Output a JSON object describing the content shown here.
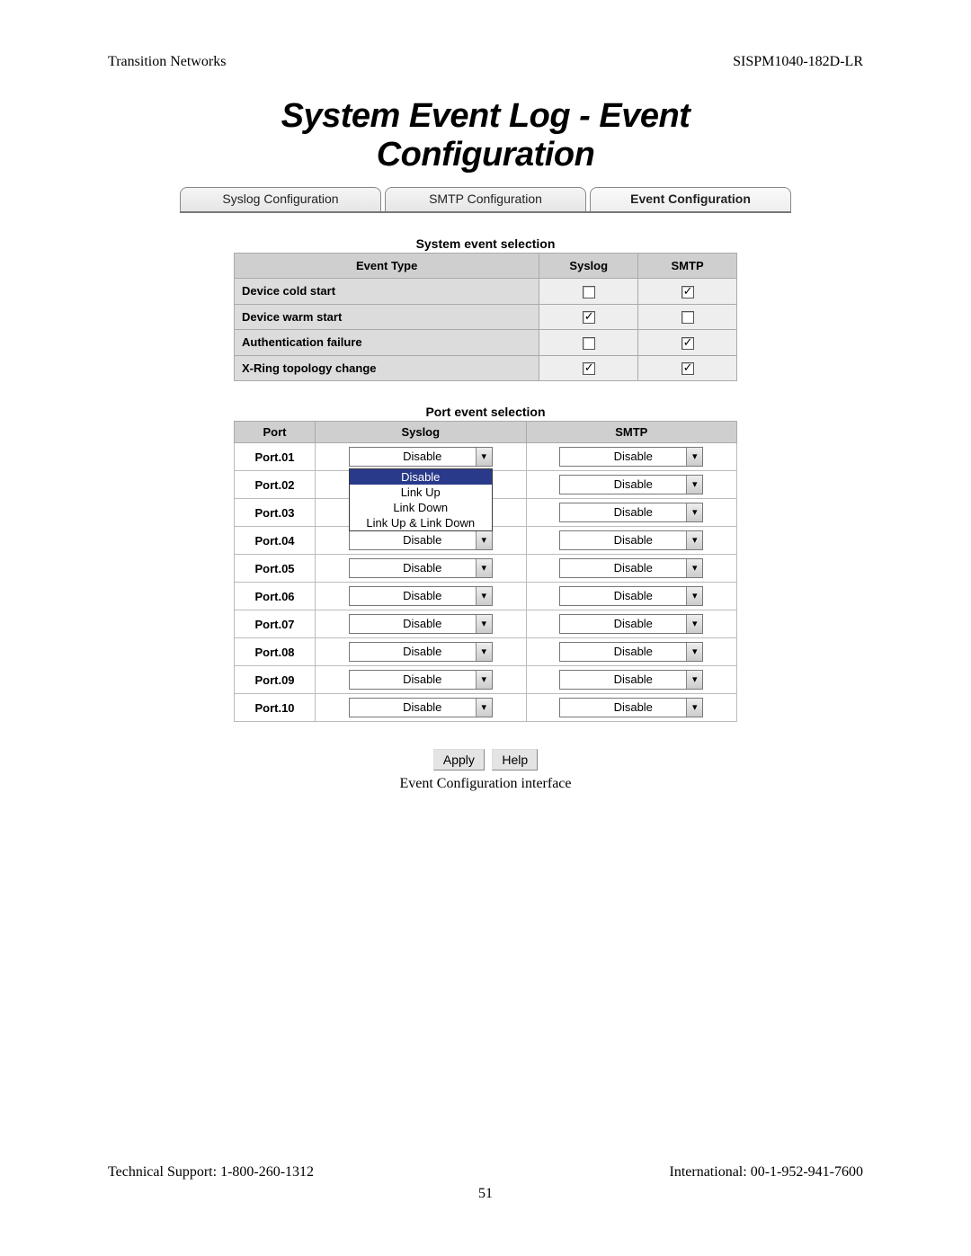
{
  "doc": {
    "vendor": "Transition Networks",
    "model": "SISPM1040-182D-LR",
    "tech_support": "Technical Support: 1-800-260-1312",
    "international": "International: 00-1-952-941-7600",
    "page_number": "51",
    "caption": "Event Configuration interface"
  },
  "title": "System Event Log - Event Configuration",
  "tabs": [
    {
      "label": "Syslog Configuration",
      "active": false
    },
    {
      "label": "SMTP Configuration",
      "active": false
    },
    {
      "label": "Event Configuration",
      "active": true
    }
  ],
  "system_event": {
    "caption": "System event selection",
    "headers": {
      "event_type": "Event Type",
      "syslog": "Syslog",
      "smtp": "SMTP"
    },
    "rows": [
      {
        "name": "Device cold start",
        "syslog": false,
        "smtp": true
      },
      {
        "name": "Device warm start",
        "syslog": true,
        "smtp": false
      },
      {
        "name": "Authentication failure",
        "syslog": false,
        "smtp": true
      },
      {
        "name": "X-Ring topology change",
        "syslog": true,
        "smtp": true
      }
    ]
  },
  "port_event": {
    "caption": "Port event selection",
    "headers": {
      "port": "Port",
      "syslog": "Syslog",
      "smtp": "SMTP"
    },
    "dropdown_options": [
      "Disable",
      "Link Up",
      "Link Down",
      "Link Up & Link Down"
    ],
    "open_dropdown_port": "Port.01",
    "open_dropdown_selected": "Disable",
    "rows": [
      {
        "port": "Port.01",
        "syslog": "Disable",
        "smtp": "Disable"
      },
      {
        "port": "Port.02",
        "syslog": "Disable",
        "smtp": "Disable"
      },
      {
        "port": "Port.03",
        "syslog": "Disable",
        "smtp": "Disable"
      },
      {
        "port": "Port.04",
        "syslog": "Disable",
        "smtp": "Disable"
      },
      {
        "port": "Port.05",
        "syslog": "Disable",
        "smtp": "Disable"
      },
      {
        "port": "Port.06",
        "syslog": "Disable",
        "smtp": "Disable"
      },
      {
        "port": "Port.07",
        "syslog": "Disable",
        "smtp": "Disable"
      },
      {
        "port": "Port.08",
        "syslog": "Disable",
        "smtp": "Disable"
      },
      {
        "port": "Port.09",
        "syslog": "Disable",
        "smtp": "Disable"
      },
      {
        "port": "Port.10",
        "syslog": "Disable",
        "smtp": "Disable"
      }
    ]
  },
  "buttons": {
    "apply": "Apply",
    "help": "Help"
  }
}
